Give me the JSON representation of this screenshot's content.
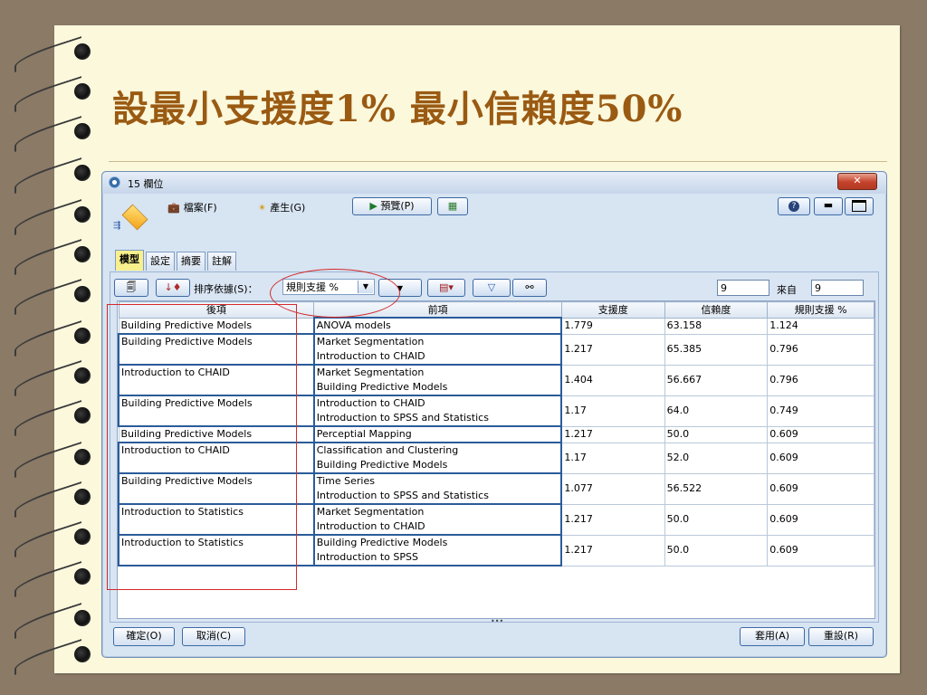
{
  "slide": {
    "title": "設最小支援度1% 最小信賴度50%"
  },
  "window": {
    "title": "15 欄位",
    "close_label": "✕"
  },
  "toolbar": {
    "file_menu": "檔案(F)",
    "generate_menu": "產生(G)",
    "preview_button": "預覽(P)"
  },
  "tabs": [
    {
      "label": "模型",
      "active": true
    },
    {
      "label": "設定",
      "active": false
    },
    {
      "label": "摘要",
      "active": false
    },
    {
      "label": "註解",
      "active": false
    }
  ],
  "sort": {
    "label": "排序依據(S)：",
    "selected": "規則支援 %"
  },
  "paging": {
    "shown": "9",
    "from_label": "來自",
    "total": "9"
  },
  "table": {
    "headers": [
      "後項",
      "前項",
      "支援度",
      "信賴度",
      "規則支援 %"
    ],
    "rows": [
      {
        "consequent": "Building Predictive Models",
        "antecedents": [
          "ANOVA models"
        ],
        "support": "1.779",
        "confidence": "63.158",
        "rule_support": "1.124"
      },
      {
        "consequent": "Building Predictive Models",
        "antecedents": [
          "Market Segmentation",
          "Introduction to CHAID"
        ],
        "support": "1.217",
        "confidence": "65.385",
        "rule_support": "0.796"
      },
      {
        "consequent": "Introduction to CHAID",
        "antecedents": [
          "Market Segmentation",
          "Building Predictive Models"
        ],
        "support": "1.404",
        "confidence": "56.667",
        "rule_support": "0.796"
      },
      {
        "consequent": "Building Predictive Models",
        "antecedents": [
          "Introduction to CHAID",
          "Introduction to SPSS and Statistics"
        ],
        "support": "1.17",
        "confidence": "64.0",
        "rule_support": "0.749"
      },
      {
        "consequent": "Building Predictive Models",
        "antecedents": [
          "Perceptial Mapping"
        ],
        "support": "1.217",
        "confidence": "50.0",
        "rule_support": "0.609"
      },
      {
        "consequent": "Introduction to CHAID",
        "antecedents": [
          "Classification and Clustering",
          "Building Predictive Models"
        ],
        "support": "1.17",
        "confidence": "52.0",
        "rule_support": "0.609"
      },
      {
        "consequent": "Building Predictive Models",
        "antecedents": [
          "Time Series",
          "Introduction to SPSS and Statistics"
        ],
        "support": "1.077",
        "confidence": "56.522",
        "rule_support": "0.609"
      },
      {
        "consequent": "Introduction to Statistics",
        "antecedents": [
          "Market Segmentation",
          "Introduction to CHAID"
        ],
        "support": "1.217",
        "confidence": "50.0",
        "rule_support": "0.609"
      },
      {
        "consequent": "Introduction to Statistics",
        "antecedents": [
          "Building Predictive Models",
          "Introduction to SPSS"
        ],
        "support": "1.217",
        "confidence": "50.0",
        "rule_support": "0.609"
      }
    ]
  },
  "footer": {
    "ok": "確定(O)",
    "cancel": "取消(C)",
    "apply": "套用(A)",
    "reset": "重設(R)"
  },
  "colors": {
    "title": "#9a5a12",
    "annotation": "#d32a2a"
  }
}
